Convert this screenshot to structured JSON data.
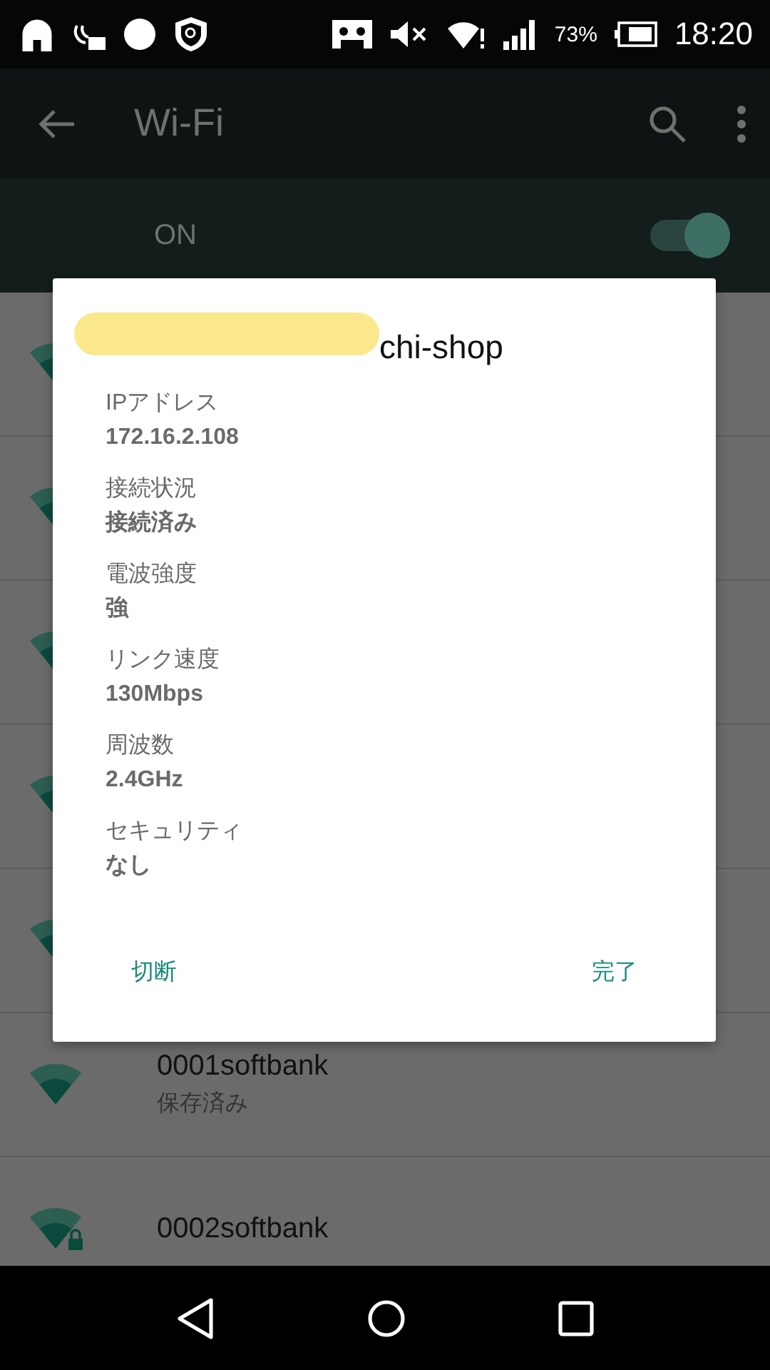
{
  "status_bar": {
    "battery": "73%",
    "time": "18:20"
  },
  "toolbar": {
    "title": "Wi-Fi"
  },
  "wifi_switch": {
    "label": "ON",
    "on": true
  },
  "networks": [
    {
      "name": "0001softbank",
      "status": "保存済み",
      "locked": false
    },
    {
      "name": "0002softbank",
      "locked": true
    }
  ],
  "dialog": {
    "title": "chi-shop",
    "details": [
      {
        "label": "IPアドレス",
        "value": "172.16.2.108"
      },
      {
        "label": "接続状況",
        "value": "接続済み"
      },
      {
        "label": "電波強度",
        "value": "強"
      },
      {
        "label": "リンク速度",
        "value": "130Mbps"
      },
      {
        "label": "周波数",
        "value": "2.4GHz"
      },
      {
        "label": "セキュリティ",
        "value": "なし"
      }
    ],
    "buttons": [
      "切断",
      "完了"
    ]
  }
}
